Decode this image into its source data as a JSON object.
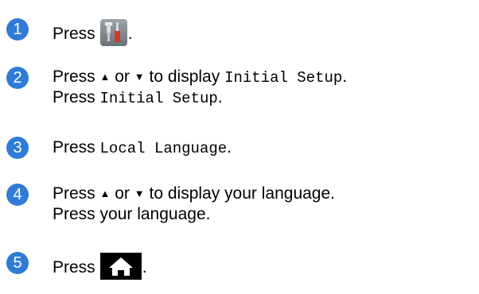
{
  "colors": {
    "step_badge": "#2f7bd6",
    "tools_icon_bg": "#858b92",
    "home_icon_bg": "#000000"
  },
  "steps": [
    {
      "number": "1",
      "parts": [
        "Press",
        "."
      ],
      "icon": "settings-tools-icon"
    },
    {
      "number": "2",
      "line1": {
        "a": "Press",
        "up": "▲",
        "or": "or",
        "down": "▼",
        "b": "to display",
        "mono": "Initial Setup",
        "end": "."
      },
      "line2": {
        "a": "Press",
        "mono": "Initial Setup",
        "end": "."
      }
    },
    {
      "number": "3",
      "line1": {
        "a": "Press",
        "mono": "Local Language",
        "end": "."
      }
    },
    {
      "number": "4",
      "line1": {
        "a": "Press",
        "up": "▲",
        "or": "or",
        "down": "▼",
        "b": "to display your language."
      },
      "line2": {
        "a": "Press your language."
      }
    },
    {
      "number": "5",
      "parts": [
        "Press",
        "."
      ],
      "icon": "home-icon"
    }
  ]
}
